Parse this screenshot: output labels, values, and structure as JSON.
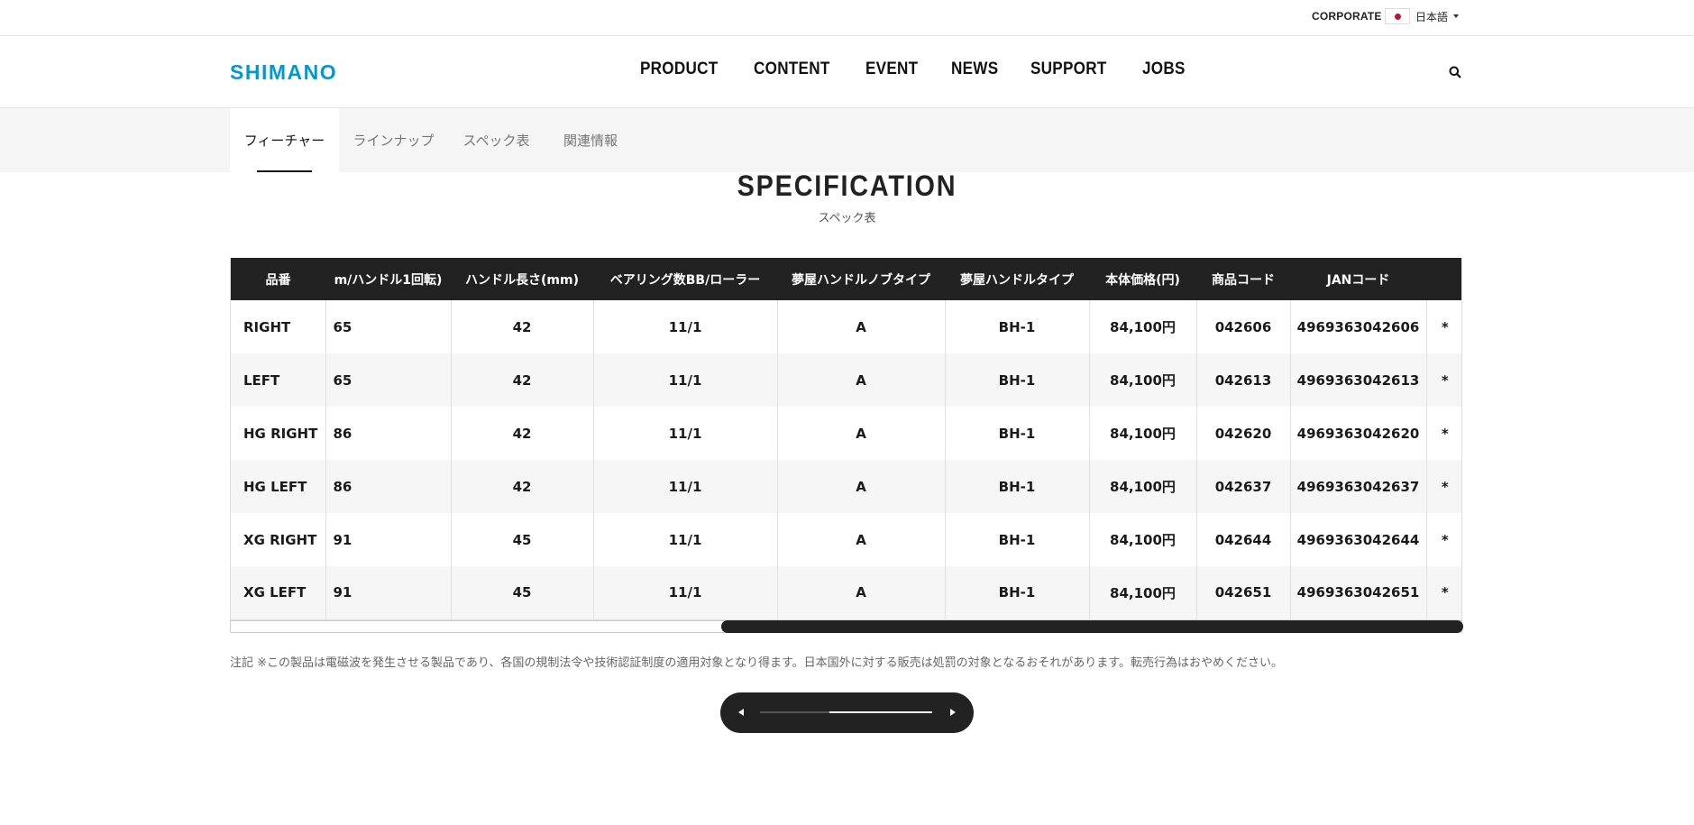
{
  "utility": {
    "corporate": "CORPORATE",
    "language": "日本語"
  },
  "header": {
    "logo": "SHIMANO",
    "nav": [
      "PRODUCT",
      "CONTENT",
      "EVENT",
      "NEWS",
      "SUPPORT",
      "JOBS"
    ]
  },
  "subnav": {
    "tabs": [
      "フィーチャー",
      "ラインナップ",
      "スペック表",
      "関連情報"
    ],
    "active": "フィーチャー"
  },
  "section": {
    "title": "SPECIFICATION",
    "subtitle": "スペック表"
  },
  "table": {
    "headers": [
      "品番",
      "m/ハンドル1回転)",
      "ハンドル長さ(mm)",
      "ベアリング数BB/ローラー",
      "夢屋ハンドルノブタイプ",
      "夢屋ハンドルタイプ",
      "本体価格(円)",
      "商品コード",
      "JANコード",
      ""
    ],
    "rows": [
      [
        "RIGHT",
        "65",
        "42",
        "11/1",
        "A",
        "BH-1",
        "84,100円",
        "042606",
        "4969363042606",
        "*"
      ],
      [
        "LEFT",
        "65",
        "42",
        "11/1",
        "A",
        "BH-1",
        "84,100円",
        "042613",
        "4969363042613",
        "*"
      ],
      [
        "HG RIGHT",
        "86",
        "42",
        "11/1",
        "A",
        "BH-1",
        "84,100円",
        "042620",
        "4969363042620",
        "*"
      ],
      [
        "HG LEFT",
        "86",
        "42",
        "11/1",
        "A",
        "BH-1",
        "84,100円",
        "042637",
        "4969363042637",
        "*"
      ],
      [
        "XG RIGHT",
        "91",
        "45",
        "11/1",
        "A",
        "BH-1",
        "84,100円",
        "042644",
        "4969363042644",
        "*"
      ],
      [
        "XG LEFT",
        "91",
        "45",
        "11/1",
        "A",
        "BH-1",
        "84,100円",
        "042651",
        "4969363042651",
        "*"
      ]
    ]
  },
  "note": "注記 ※この製品は電磁波を発生させる製品であり、各国の規制法令や技術認証制度の適用対象となり得ます。日本国外に対する販売は処罰の対象となるおそれがあります。転売行為はおやめください。",
  "colors": {
    "brand": "#0099d6",
    "header_bg": "#222222"
  },
  "icons": {
    "search": "search-icon",
    "flag": "japan-flag-icon",
    "prev": "arrow-left-icon",
    "next": "arrow-right-icon"
  }
}
